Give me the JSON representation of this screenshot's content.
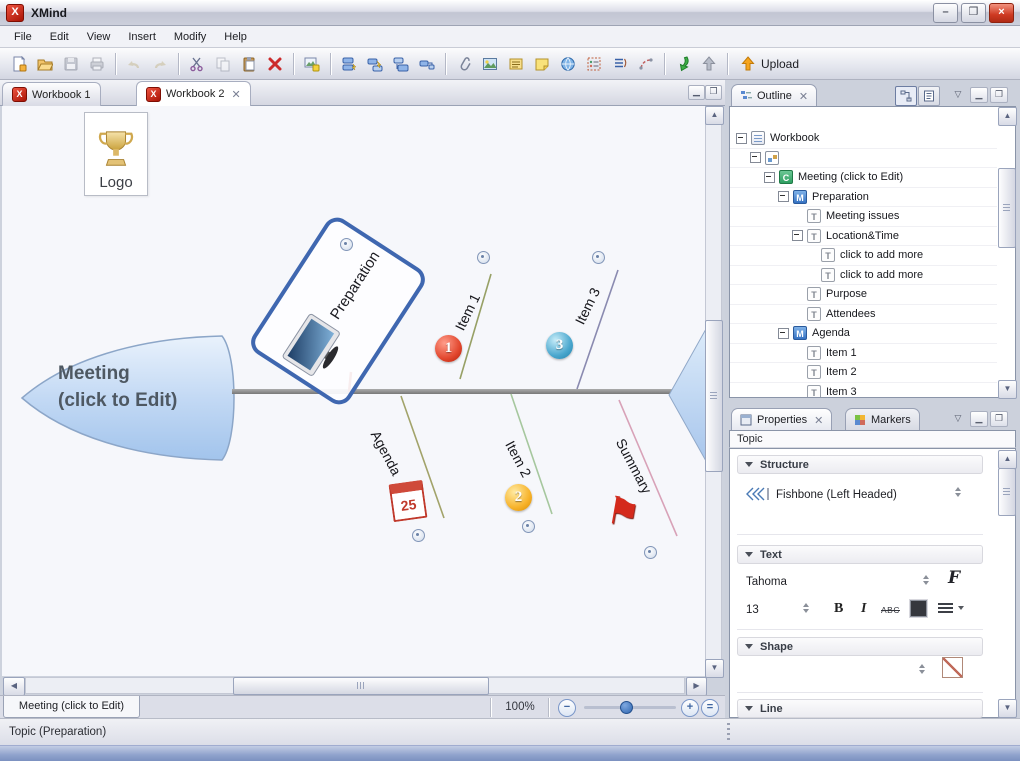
{
  "window": {
    "title": "XMind",
    "controls": {
      "minimize": "–",
      "maximize": "❐",
      "close": "×"
    }
  },
  "menu": {
    "items": [
      "File",
      "Edit",
      "View",
      "Insert",
      "Modify",
      "Help"
    ]
  },
  "toolbar": {
    "icons": [
      "new-workbook-icon",
      "open-icon",
      "save-icon",
      "print-icon",
      "undo-icon",
      "redo-icon",
      "cut-icon",
      "copy-icon",
      "paste-icon",
      "delete-icon",
      "export-image-icon",
      "insert-topic-icon",
      "insert-subtopic-icon",
      "insert-topic-before-icon",
      "insert-parent-topic-icon",
      "attachment-icon",
      "insert-image-icon",
      "notes-icon",
      "label-icon",
      "hyperlink-icon",
      "legend-icon",
      "numbering-icon",
      "relationship-icon",
      "sync-down-icon",
      "share-up-icon",
      "upload-icon"
    ],
    "upload_label": "Upload"
  },
  "editor": {
    "tabs": [
      {
        "label": "Workbook 1"
      },
      {
        "label": "Workbook 2"
      }
    ],
    "sheet_tab_label": "Meeting (click to Edit)",
    "zoom_value": "100%"
  },
  "canvas": {
    "logo_label": "Logo",
    "head_line1": "Meeting",
    "head_line2": "(click to Edit)",
    "branches": {
      "preparation": "Preparation",
      "item1": "Item 1",
      "item2": "Item 2",
      "item3": "Item 3",
      "agenda": "Agenda",
      "summary": "Summary"
    },
    "badges": {
      "item1": "1",
      "item2": "2",
      "item3": "3"
    },
    "calendar_day": "25"
  },
  "outline": {
    "title": "Outline",
    "tree": [
      {
        "label": "Workbook",
        "icon": "workbook",
        "depth": 0
      },
      {
        "label": "",
        "icon": "sheet",
        "depth": 1
      },
      {
        "label": "Meeting (click to Edit)",
        "icon": "central-topic",
        "depth": 2
      },
      {
        "label": "Preparation",
        "icon": "main-topic",
        "depth": 3
      },
      {
        "label": "Meeting issues",
        "icon": "topic",
        "depth": 4
      },
      {
        "label": "Location&Time",
        "icon": "topic",
        "depth": 4
      },
      {
        "label": "click to add more",
        "icon": "topic",
        "depth": 5
      },
      {
        "label": "click to add more",
        "icon": "topic",
        "depth": 5
      },
      {
        "label": "Purpose",
        "icon": "topic",
        "depth": 4
      },
      {
        "label": "Attendees",
        "icon": "topic",
        "depth": 4
      },
      {
        "label": "Agenda",
        "icon": "main-topic",
        "depth": 3
      },
      {
        "label": "Item 1",
        "icon": "topic",
        "depth": 4
      },
      {
        "label": "Item 2",
        "icon": "topic",
        "depth": 4
      },
      {
        "label": "Item 3",
        "icon": "topic",
        "depth": 4
      }
    ]
  },
  "properties": {
    "tab_properties": "Properties",
    "tab_markers": "Markers",
    "context": "Topic",
    "structure": {
      "header": "Structure",
      "value": "Fishbone (Left Headed)"
    },
    "text": {
      "header": "Text",
      "font": "Tahoma",
      "size": "13",
      "bold": "B",
      "italic": "I",
      "strike": "ABC"
    },
    "shape": {
      "header": "Shape"
    },
    "line": {
      "header": "Line"
    }
  },
  "statusbar": {
    "text": "Topic (Preparation)"
  }
}
